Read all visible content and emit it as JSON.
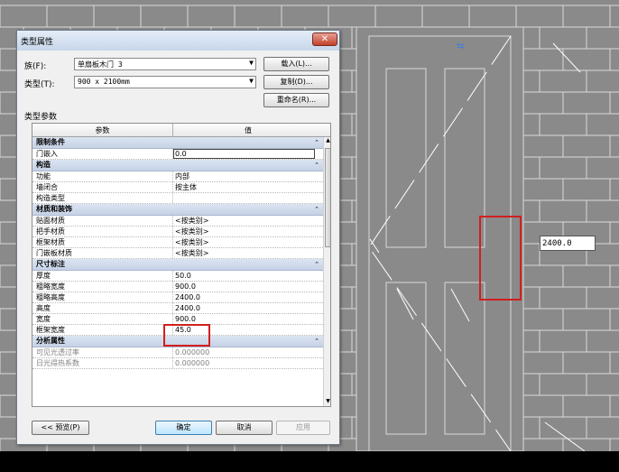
{
  "dialog": {
    "title": "类型属性",
    "close_glyph": "✕",
    "family_label": "族(F):",
    "family_value": "单扇板木门 3",
    "type_label": "类型(T):",
    "type_value": "900 x 2100mm",
    "load_button": "载入(L)...",
    "duplicate_button": "复制(D)...",
    "rename_button": "重命名(R)...",
    "section_label": "类型参数",
    "grid_headers": {
      "param": "参数",
      "value": "值"
    },
    "rows": [
      {
        "kind": "group",
        "name": "限制条件"
      },
      {
        "kind": "item",
        "name": "门嵌入",
        "value": "0.0",
        "editing": true
      },
      {
        "kind": "group",
        "name": "构造"
      },
      {
        "kind": "item",
        "name": "功能",
        "value": "内部"
      },
      {
        "kind": "item",
        "name": "墙闭合",
        "value": "按主体"
      },
      {
        "kind": "item",
        "name": "构造类型",
        "value": ""
      },
      {
        "kind": "group",
        "name": "材质和装饰"
      },
      {
        "kind": "item",
        "name": "贴面材质",
        "value": "<按类别>"
      },
      {
        "kind": "item",
        "name": "把手材质",
        "value": "<按类别>"
      },
      {
        "kind": "item",
        "name": "框架材质",
        "value": "<按类别>"
      },
      {
        "kind": "item",
        "name": "门嵌板材质",
        "value": "<按类别>"
      },
      {
        "kind": "group",
        "name": "尺寸标注"
      },
      {
        "kind": "item",
        "name": "厚度",
        "value": "50.0"
      },
      {
        "kind": "item",
        "name": "粗略宽度",
        "value": "900.0"
      },
      {
        "kind": "item",
        "name": "粗略高度",
        "value": "2400.0"
      },
      {
        "kind": "item",
        "name": "高度",
        "value": "2400.0"
      },
      {
        "kind": "item",
        "name": "宽度",
        "value": "900.0"
      },
      {
        "kind": "item",
        "name": "框架宽度",
        "value": "45.0"
      },
      {
        "kind": "group",
        "name": "分析属性"
      },
      {
        "kind": "item",
        "name": "可见光透过率",
        "value": "0.000000",
        "gray": true
      },
      {
        "kind": "item",
        "name": "日光得热系数",
        "value": "0.000000",
        "gray": true
      }
    ],
    "preview_button": "<< 预览(P)",
    "ok_button": "确定",
    "cancel_button": "取消",
    "apply_button": "应用"
  },
  "viewport": {
    "dimension_value": "2400.0",
    "flip_glyph": "⇆"
  },
  "colors": {
    "highlight": "#d21f1f",
    "viewport_bg": "#8a8a8a",
    "wall_lines": "#d9d9d9"
  }
}
